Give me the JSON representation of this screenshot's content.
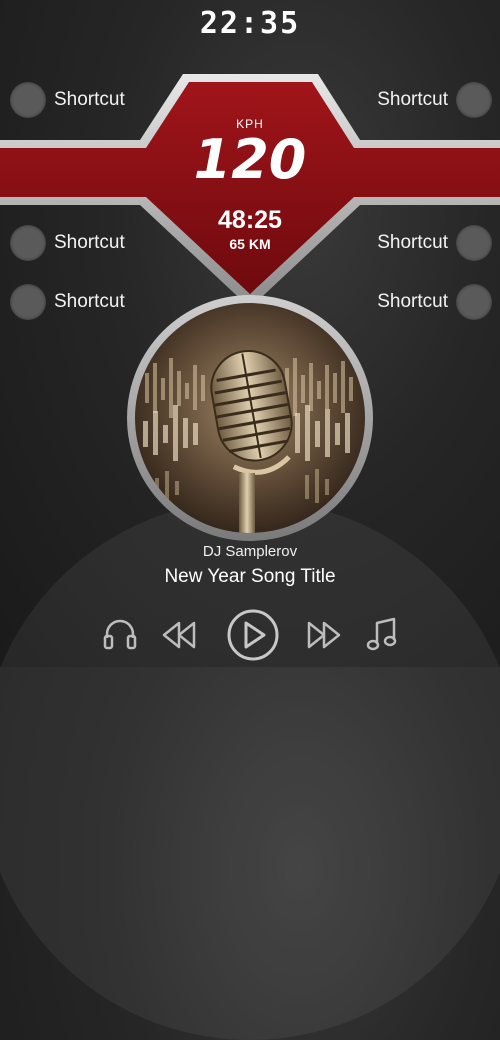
{
  "status": {
    "clock": "22:35"
  },
  "shortcuts": [
    {
      "label": "Shortcut",
      "side": "left"
    },
    {
      "label": "Shortcut",
      "side": "right"
    },
    {
      "label": "Shortcut",
      "side": "left"
    },
    {
      "label": "Shortcut",
      "side": "right"
    },
    {
      "label": "Shortcut",
      "side": "left"
    },
    {
      "label": "Shortcut",
      "side": "right"
    }
  ],
  "speedometer": {
    "unit": "KPH",
    "value": "120"
  },
  "trip": {
    "time": "48:25",
    "distance": "65 KM"
  },
  "now_playing": {
    "artist": "DJ Samplerov",
    "title": "New Year Song Title"
  },
  "controls": [
    {
      "name": "headphones-icon"
    },
    {
      "name": "rewind-icon"
    },
    {
      "name": "play-icon"
    },
    {
      "name": "fast-forward-icon"
    },
    {
      "name": "music-note-icon"
    }
  ],
  "colors": {
    "banner_red": "#8e0f14",
    "silver": "#bdbdbd",
    "background": "#262626"
  }
}
